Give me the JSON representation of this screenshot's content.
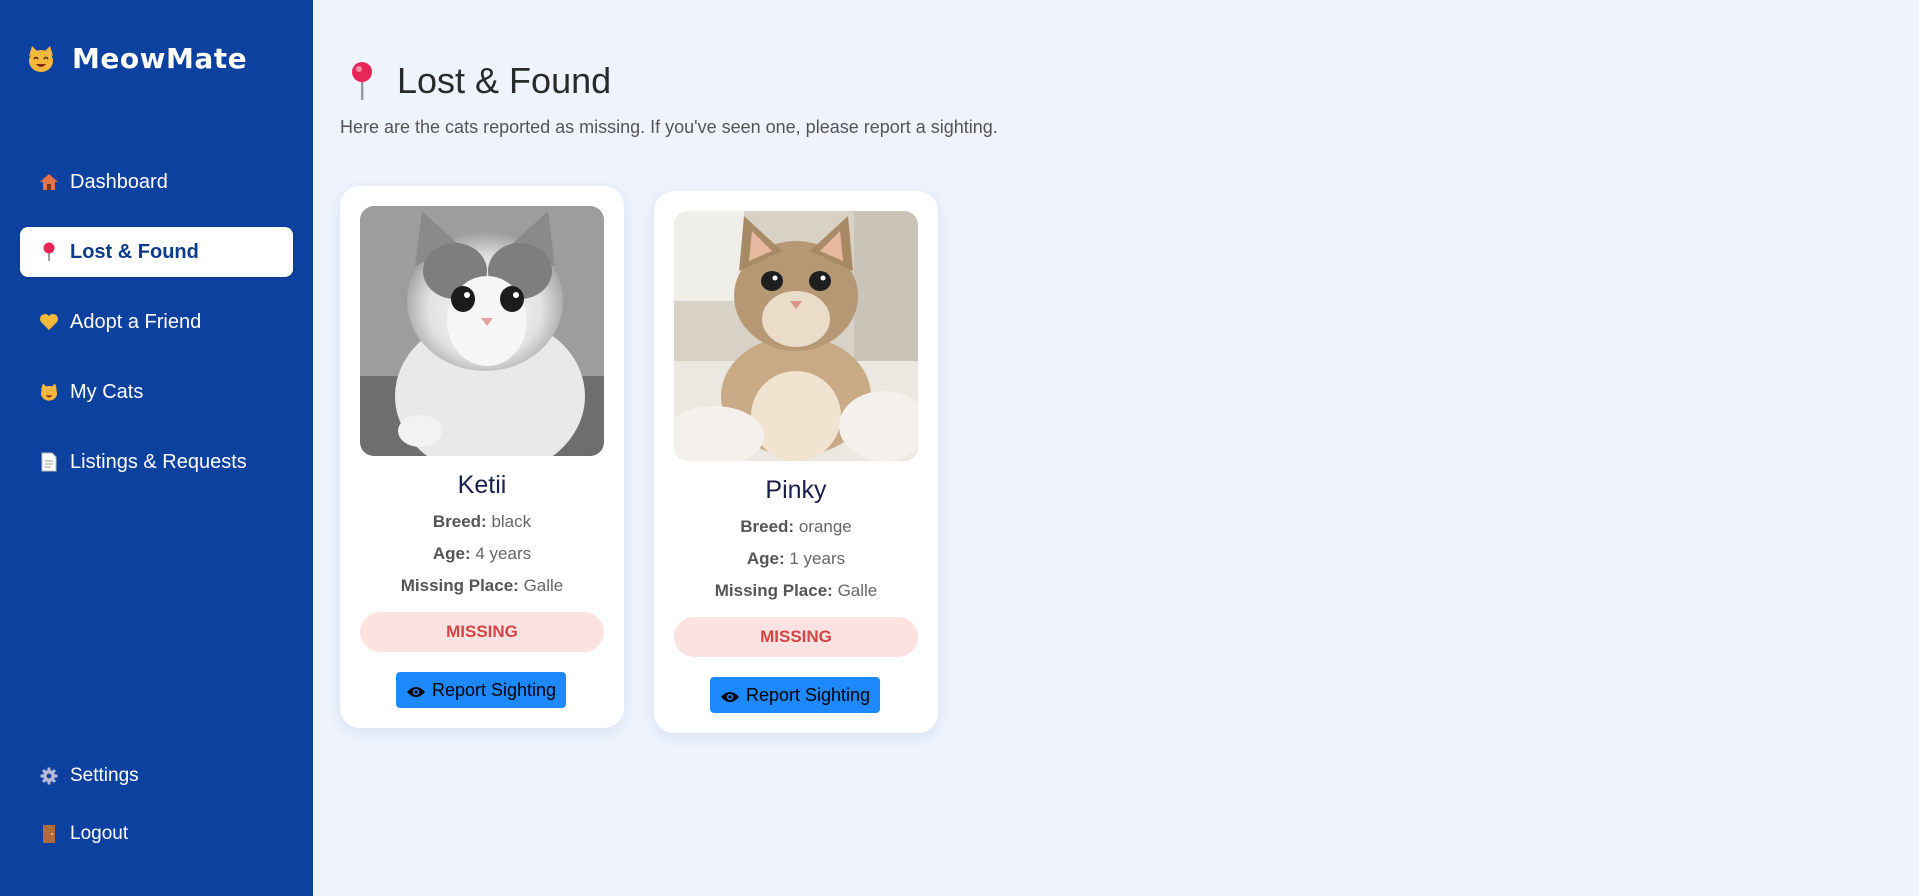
{
  "sidebar": {
    "brand": {
      "name": "MeowMate",
      "icon": "cat-face-icon"
    },
    "items": [
      {
        "label": "Dashboard",
        "icon": "house-icon",
        "active": false
      },
      {
        "label": "Lost & Found",
        "icon": "pin-icon",
        "active": true
      },
      {
        "label": "Adopt a Friend",
        "icon": "heart-icon",
        "active": false
      },
      {
        "label": "My Cats",
        "icon": "cat-face-icon",
        "active": false
      },
      {
        "label": "Listings & Requests",
        "icon": "document-icon",
        "active": false
      }
    ],
    "bottom_items": [
      {
        "label": "Settings",
        "icon": "gear-icon"
      },
      {
        "label": "Logout",
        "icon": "door-icon"
      }
    ]
  },
  "page": {
    "title": "Lost & Found",
    "subtitle": "Here are the cats reported as missing. If you've seen one, please report a sighting."
  },
  "cats": [
    {
      "name": "Ketii",
      "breed_label": "Breed:",
      "breed": "black",
      "age_label": "Age:",
      "age": "4 years",
      "place_label": "Missing Place:",
      "place": "Galle",
      "status": "MISSING",
      "action": "Report Sighting",
      "photo": "grey-white-fluffy-kitten-photo"
    },
    {
      "name": "Pinky",
      "breed_label": "Breed:",
      "breed": "orange",
      "age_label": "Age:",
      "age": "1 years",
      "place_label": "Missing Place:",
      "place": "Galle",
      "status": "MISSING",
      "action": "Report Sighting",
      "photo": "tan-cat-on-bed-photo"
    }
  ],
  "colors": {
    "sidebar": "#0d41a0",
    "background": "#eef3fd",
    "status_bg": "#fde2e2",
    "status_text": "#d64545",
    "button": "#1e88ff"
  }
}
